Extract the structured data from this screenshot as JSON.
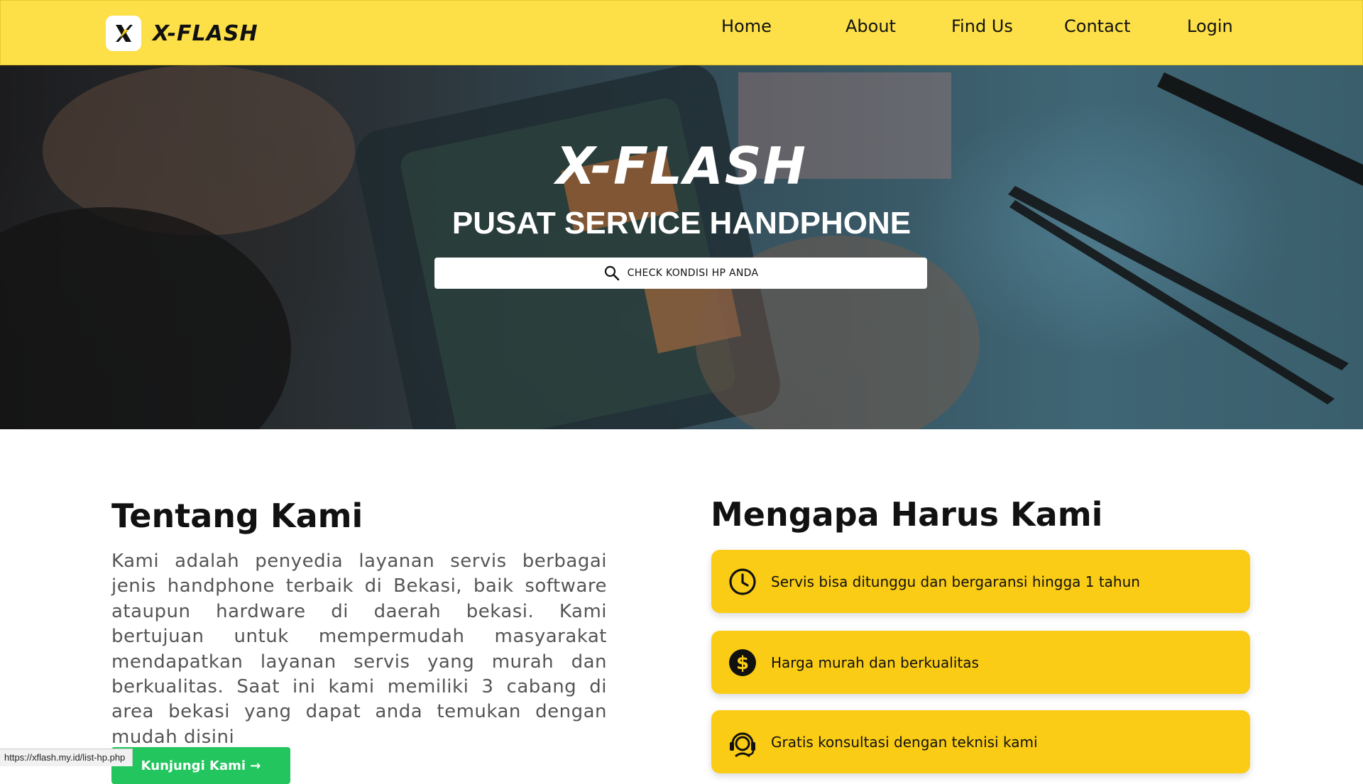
{
  "brand": {
    "name": "X-FLASH"
  },
  "nav": {
    "items": [
      "Home",
      "About",
      "Find Us",
      "Contact",
      "Login"
    ]
  },
  "hero": {
    "title": "X-FLASH",
    "subtitle": "PUSAT SERVICE HANDPHONE",
    "search_label": "CHECK KONDISI HP ANDA"
  },
  "about": {
    "title": "Tentang Kami",
    "text": "Kami adalah penyedia layanan servis berbagai jenis handphone terbaik di Bekasi, baik software ataupun hardware di daerah bekasi. Kami bertujuan untuk mempermudah masyarakat mendapatkan layanan servis yang murah dan berkualitas. Saat ini kami memiliki 3 cabang di area bekasi yang dapat anda temukan dengan mudah disini",
    "button_label": "Kunjungi Kami →"
  },
  "why": {
    "title": "Mengapa Harus Kami",
    "items": [
      {
        "text": "Servis bisa ditunggu dan bergaransi hingga 1 tahun",
        "icon": "clock-icon"
      },
      {
        "text": "Harga murah dan berkualitas",
        "icon": "dollar-icon"
      },
      {
        "text": "Gratis konsultasi dengan teknisi kami",
        "icon": "headset-icon"
      }
    ]
  },
  "status_bar": {
    "url": "https://xflash.my.id/list-hp.php"
  },
  "colors": {
    "navbar": "#fde047",
    "card": "#facc15",
    "button": "#22c55e"
  }
}
